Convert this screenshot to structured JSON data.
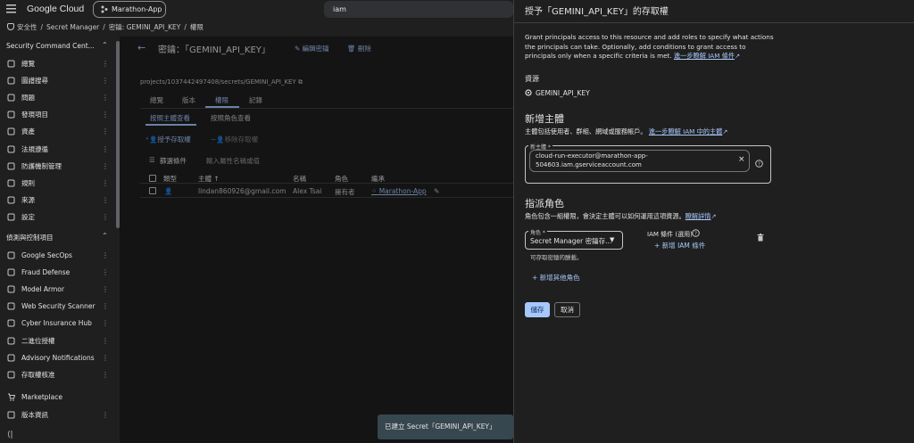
{
  "topbar": {
    "logo": "Google Cloud",
    "project": "Marathon-App",
    "search_value": "iam"
  },
  "breadcrumb": [
    "安全性",
    "/",
    "Secret Manager",
    "/",
    "密鑰: GEMINI_API_KEY",
    "/",
    "權限"
  ],
  "sidebar": {
    "section1": "Security Command Cent...",
    "items1": [
      {
        "label": "總覽",
        "icon": "dashboard-icon"
      },
      {
        "label": "圖譜搜尋",
        "icon": "graph-icon"
      },
      {
        "label": "問題",
        "icon": "issue-icon"
      },
      {
        "label": "發現項目",
        "icon": "findings-icon"
      },
      {
        "label": "資產",
        "icon": "assets-icon"
      },
      {
        "label": "法規遵循",
        "icon": "compliance-icon"
      },
      {
        "label": "防護機制管理",
        "icon": "guard-icon"
      },
      {
        "label": "規則",
        "icon": "rules-icon"
      },
      {
        "label": "來源",
        "icon": "sources-icon"
      },
      {
        "label": "設定",
        "icon": "gear-icon"
      }
    ],
    "section2": "偵測與控制項目",
    "items2": [
      {
        "label": "Google SecOps",
        "icon": "secops-icon"
      },
      {
        "label": "Fraud Defense",
        "icon": "shield-icon"
      },
      {
        "label": "Model Armor",
        "icon": "armor-icon"
      },
      {
        "label": "Web Security Scanner",
        "icon": "scanner-icon"
      },
      {
        "label": "Cyber Insurance Hub",
        "icon": "insurance-icon"
      },
      {
        "label": "二進位授權",
        "icon": "binary-icon"
      },
      {
        "label": "Advisory Notifications",
        "icon": "bell-icon"
      },
      {
        "label": "存取權核准",
        "icon": "approval-icon"
      }
    ],
    "marketplace": "Marketplace",
    "release_notes": "版本資訊"
  },
  "main": {
    "title": "密鑰：「GEMINI_API_KEY」",
    "edit": "編輯密鑰",
    "delete": "刪除",
    "path": "projects/1037442497408/secrets/GEMINI_API_KEY",
    "tabs": [
      "總覽",
      "版本",
      "權限",
      "記錄"
    ],
    "subtabs": [
      "按照主體查看",
      "按照角色查看"
    ],
    "grant": "授予存取權",
    "remove": "移除存取權",
    "filter_label": "篩選條件",
    "filter_placeholder": "輸入屬性名稱或值",
    "columns": [
      "類型",
      "主體",
      "名稱",
      "角色",
      "繼承"
    ],
    "row": {
      "principal": "lindan860926@gmail.com",
      "name": "Alex Tsai",
      "role": "擁有者",
      "inherit": "Marathon-App"
    }
  },
  "toast": "已建立 Secret「GEMINI_API_KEY」",
  "panel": {
    "title": "授予「GEMINI_API_KEY」的存取權",
    "desc": "Grant principals access to this resource and add roles to specify what actions the principals can take. Optionally, add conditions to grant access to principals only when a specific criteria is met.",
    "desc_link": "進一步瞭解 IAM 條件",
    "resource_label": "資源",
    "resource_value": "GEMINI_API_KEY",
    "new_principal_heading": "新增主體",
    "new_principal_desc": "主體包括使用者、群組、網域或服務帳戶。",
    "new_principal_link": "進一步瞭解 IAM 中的主體",
    "principal_field_label": "新主體 *",
    "principal_value": "cloud-run-executor@marathon-app-504603.iam.gserviceaccount.com",
    "assign_heading": "指派角色",
    "assign_desc": "角色包含一組權限，會決定主體可以如何運用這項資源。",
    "assign_link": "瞭解詳情",
    "role_label": "角色 *",
    "role_value": "Secret Manager 密鑰存...",
    "role_hint": "可存取密鑰的酬載。",
    "condition_label": "IAM 條件 (選用)",
    "add_condition": "新增 IAM 條件",
    "add_role": "新增其他角色",
    "save": "儲存",
    "cancel": "取消"
  },
  "colors": {
    "accent": "#a8c7fa",
    "background": "#1f1f1f"
  }
}
